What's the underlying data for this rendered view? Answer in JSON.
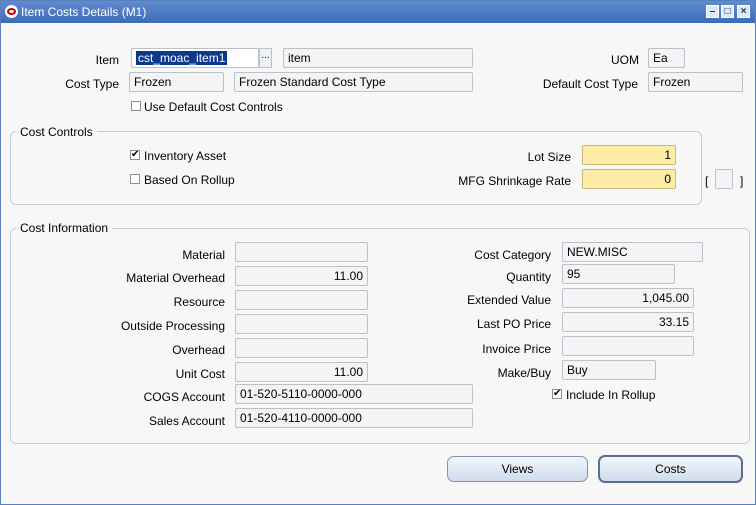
{
  "window": {
    "title": "Item Costs Details (M1)"
  },
  "header": {
    "item_label": "Item",
    "item_value": "cst_moac_item1",
    "lov_glyph": "...",
    "item_desc": "item",
    "uom_label": "UOM",
    "uom_value": "Ea",
    "cost_type_label": "Cost Type",
    "cost_type_value": "Frozen",
    "cost_type_desc": "Frozen Standard Cost Type",
    "default_cost_type_label": "Default Cost Type",
    "default_cost_type_value": "Frozen",
    "use_default_label": "Use Default Cost Controls",
    "use_default_checked": false
  },
  "cost_controls": {
    "title": "Cost Controls",
    "inventory_asset_label": "Inventory Asset",
    "inventory_asset_checked": true,
    "based_on_rollup_label": "Based On Rollup",
    "based_on_rollup_checked": false,
    "lot_size_label": "Lot Size",
    "lot_size_value": "1",
    "mfg_shrinkage_label": "MFG Shrinkage Rate",
    "mfg_shrinkage_value": "0",
    "bracket_open": "[",
    "bracket_close": "]"
  },
  "cost_info": {
    "title": "Cost Information",
    "material_label": "Material",
    "material_value": "",
    "material_overhead_label": "Material Overhead",
    "material_overhead_value": "11.00",
    "resource_label": "Resource",
    "resource_value": "",
    "outside_processing_label": "Outside Processing",
    "outside_processing_value": "",
    "overhead_label": "Overhead",
    "overhead_value": "",
    "unit_cost_label": "Unit Cost",
    "unit_cost_value": "11.00",
    "cogs_account_label": "COGS Account",
    "cogs_account_value": "01-520-5110-0000-000",
    "sales_account_label": "Sales Account",
    "sales_account_value": "01-520-4110-0000-000",
    "cost_category_label": "Cost Category",
    "cost_category_value": "NEW.MISC",
    "quantity_label": "Quantity",
    "quantity_value": "95",
    "extended_value_label": "Extended Value",
    "extended_value_value": "1,045.00",
    "last_po_price_label": "Last PO Price",
    "last_po_price_value": "33.15",
    "invoice_price_label": "Invoice Price",
    "invoice_price_value": "",
    "make_buy_label": "Make/Buy",
    "make_buy_value": "Buy",
    "include_rollup_label": "Include In Rollup",
    "include_rollup_checked": true
  },
  "buttons": {
    "views": "Views",
    "costs": "Costs"
  },
  "icons": {
    "minimize": "minimize-icon",
    "maximize": "maximize-icon",
    "close": "close-icon",
    "app": "oracle-icon"
  },
  "colors": {
    "titlebar": "#3d6cb7",
    "required_field": "#fdeca6",
    "selection": "#0b3a8a"
  }
}
